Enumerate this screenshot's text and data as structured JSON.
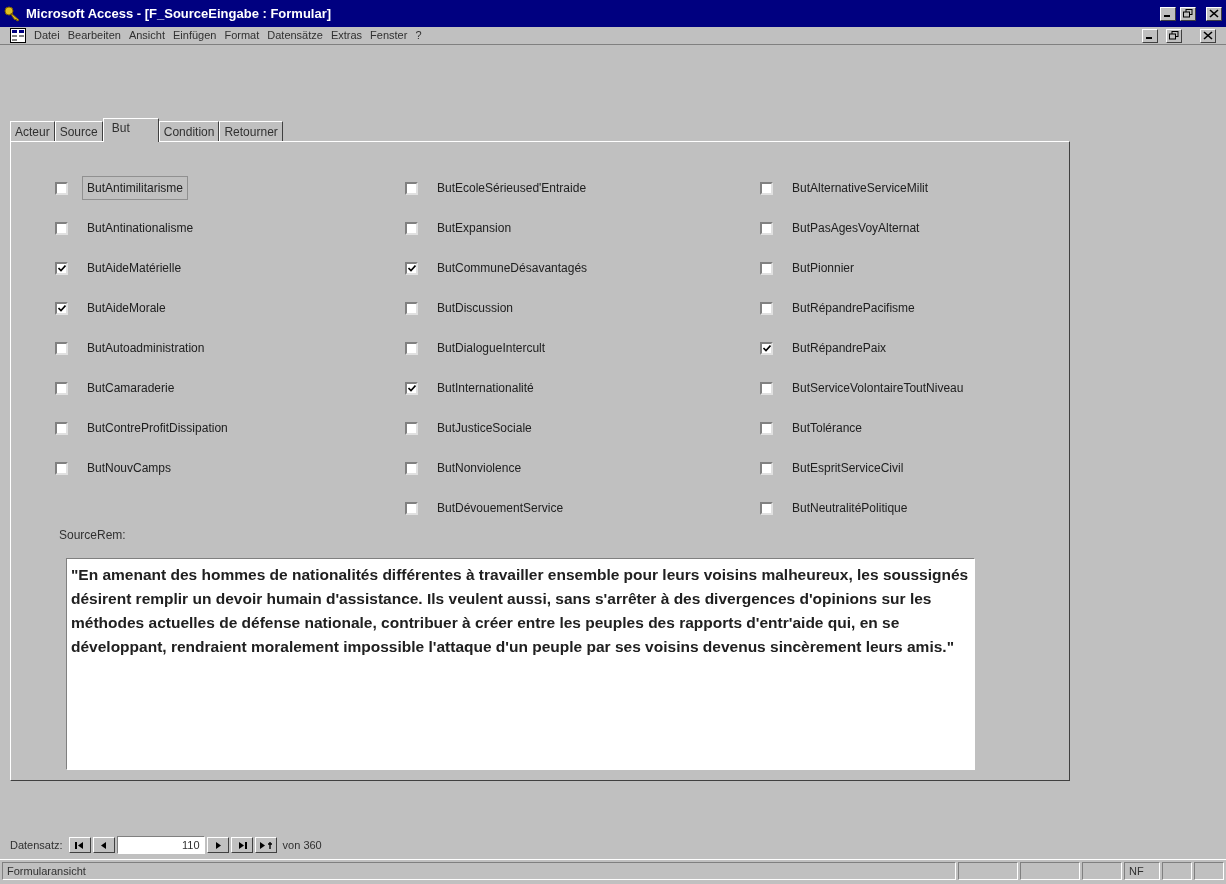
{
  "window": {
    "title": "Microsoft Access - [F_SourceEingabe : Formular]"
  },
  "menu": [
    "Datei",
    "Bearbeiten",
    "Ansicht",
    "Einfügen",
    "Format",
    "Datensätze",
    "Extras",
    "Fenster",
    "?"
  ],
  "tabs": [
    {
      "label": "Acteur",
      "selected": false
    },
    {
      "label": "Source",
      "selected": false
    },
    {
      "label": "But",
      "selected": true
    },
    {
      "label": "Condition",
      "selected": false
    },
    {
      "label": "Retourner",
      "selected": false
    }
  ],
  "columns": [
    [
      {
        "label": "ButAntimilitarisme",
        "checked": false,
        "focused": true
      },
      {
        "label": "ButAntinationalisme",
        "checked": false,
        "focused": false
      },
      {
        "label": "ButAideMatérielle",
        "checked": true,
        "focused": false
      },
      {
        "label": "ButAideMorale",
        "checked": true,
        "focused": false
      },
      {
        "label": "ButAutoadministration",
        "checked": false,
        "focused": false
      },
      {
        "label": "ButCamaraderie",
        "checked": false,
        "focused": false
      },
      {
        "label": "ButContreProfitDissipation",
        "checked": false,
        "focused": false
      },
      {
        "label": "ButNouvCamps",
        "checked": false,
        "focused": false
      }
    ],
    [
      {
        "label": "ButEcoleSérieused'Entraide",
        "checked": false,
        "focused": false
      },
      {
        "label": "ButExpansion",
        "checked": false,
        "focused": false
      },
      {
        "label": "ButCommuneDésavantagés",
        "checked": true,
        "focused": false
      },
      {
        "label": "ButDiscussion",
        "checked": false,
        "focused": false
      },
      {
        "label": "ButDialogueIntercult",
        "checked": false,
        "focused": false
      },
      {
        "label": "ButInternationalité",
        "checked": true,
        "focused": false
      },
      {
        "label": "ButJusticeSociale",
        "checked": false,
        "focused": false
      },
      {
        "label": "ButNonviolence",
        "checked": false,
        "focused": false
      },
      {
        "label": "ButDévouementService",
        "checked": false,
        "focused": false
      }
    ],
    [
      {
        "label": "ButAlternativeServiceMilit",
        "checked": false,
        "focused": false
      },
      {
        "label": "ButPasAgesVoyAlternat",
        "checked": false,
        "focused": false
      },
      {
        "label": "ButPionnier",
        "checked": false,
        "focused": false
      },
      {
        "label": "ButRépandrePacifisme",
        "checked": false,
        "focused": false
      },
      {
        "label": "ButRépandrePaix",
        "checked": true,
        "focused": false
      },
      {
        "label": "ButServiceVolontaireToutNiveau",
        "checked": false,
        "focused": false
      },
      {
        "label": "ButTolérance",
        "checked": false,
        "focused": false
      },
      {
        "label": "ButEspritServiceCivil",
        "checked": false,
        "focused": false
      },
      {
        "label": "ButNeutralitéPolitique",
        "checked": false,
        "focused": false
      }
    ]
  ],
  "remark": {
    "label": "SourceRem:",
    "value": "\"En amenant des hommes de nationalités différentes à travailler ensemble pour leurs voisins malheureux, les soussignés désirent remplir un devoir humain d'assistance. Ils veulent aussi, sans s'arrêter à des divergences d'opinions sur les méthodes actuelles de défense nationale, contribuer à créer entre les peuples des rapports d'entr'aide qui, en se développant, rendraient moralement impossible l'attaque d'un peuple par ses voisins devenus sincèrement leurs amis.\""
  },
  "navigator": {
    "label": "Datensatz:",
    "record": "110",
    "total": "von 360"
  },
  "status_bar": {
    "text": "Formularansicht",
    "indicator": "NF"
  }
}
